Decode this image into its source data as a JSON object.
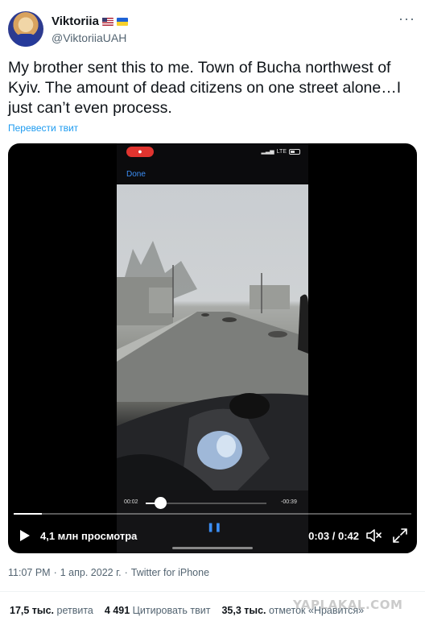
{
  "tweet": {
    "author": {
      "display_name": "Viktoriia",
      "flags": [
        "us-flag-icon",
        "ukraine-flag-icon"
      ],
      "handle": "@ViktoriiaUAH"
    },
    "more_icon": "ellipsis-icon",
    "text": "My brother sent this to me. Town of Bucha northwest of Kyiv. The amount of dead citizens on one street alone…I just can’t even process.",
    "translate_label": "Перевести твит"
  },
  "video": {
    "phone_screen": {
      "done_label": "Done",
      "network_label": "LTE",
      "elapsed": "00:02",
      "remaining": "-00:39",
      "scrubber_fraction": 0.12,
      "pause_glyph": "❚❚"
    },
    "progress_fraction": 0.071,
    "views_label": "4,1 млн просмотра",
    "time_label": "0:03 / 0:42"
  },
  "meta": {
    "time": "11:07 PM",
    "sep1": "·",
    "date": "1 апр. 2022 г.",
    "sep2": "·",
    "source": "Twitter for iPhone"
  },
  "stats": {
    "retweets_count": "17,5 тыс.",
    "retweets_label": "ретвита",
    "quotes_count": "4 491",
    "quotes_label": "Цитировать твит",
    "likes_count": "35,3 тыс.",
    "likes_label": "отметок «Нравится»"
  },
  "watermark": "YAPLAKAL.COM",
  "colors": {
    "link": "#1d9bf0",
    "secondary_text": "#536471",
    "primary_text": "#0f1419",
    "ios_blue": "#3b8ef5",
    "record_red": "#e0342f"
  }
}
